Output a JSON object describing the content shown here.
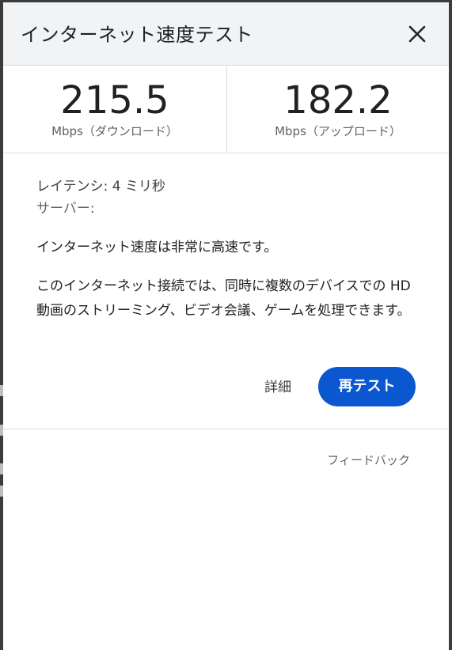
{
  "header": {
    "title": "インターネット速度テスト",
    "close_icon": "close-icon"
  },
  "download": {
    "value": "215.5",
    "unit_label": "Mbps（ダウンロード）"
  },
  "upload": {
    "value": "182.2",
    "unit_label": "Mbps（アップロード）"
  },
  "info": {
    "latency": "レイテンシ: 4 ミリ秒",
    "server": "サーバー:"
  },
  "verdict": "インターネット速度は非常に高速です。",
  "description": "このインターネット接続では、同時に複数のデバイスでの HD 動画のストリーミング、ビデオ会議、ゲームを処理できます。",
  "actions": {
    "details_label": "詳細",
    "retest_label": "再テスト"
  },
  "footer": {
    "feedback_label": "フィードバック"
  },
  "colors": {
    "accent": "#0b57d0",
    "header_bg": "#f1f3f4",
    "divider": "#dadce0"
  }
}
